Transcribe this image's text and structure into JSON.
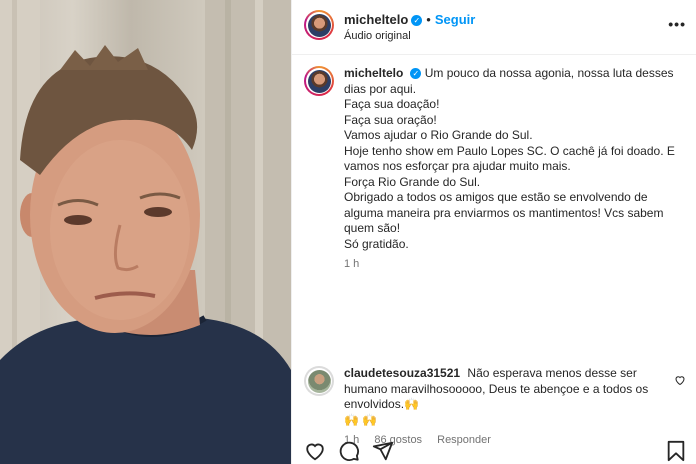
{
  "post": {
    "username": "micheltelo",
    "follow_label": "Seguir",
    "audio_label": "Áudio original",
    "more_label": "•••"
  },
  "caption": {
    "username": "micheltelo",
    "lines": [
      "Um pouco da nossa agonia, nossa luta desses dias por aqui.",
      "Faça sua doação!",
      "Faça sua oração!",
      "Vamos ajudar o Rio Grande do Sul.",
      "Hoje tenho show em Paulo Lopes SC. O cachê já foi doado. E vamos nos esforçar pra ajudar muito mais.",
      "Força Rio Grande do Sul.",
      "Obrigado a todos os amigos que estão se envolvendo de alguma maneira pra enviarmos os mantimentos! Vcs sabem quem são!",
      "Só gratidão."
    ],
    "time": "1 h"
  },
  "comment": {
    "username": "claudetesouza31521",
    "text": "Não esperava menos desse ser humano maravilhosooooo, Deus te abençoe e a todos os envolvidos.🙌",
    "emoji_line": "🙌 🙌",
    "time": "1 h",
    "likes": "86 gostos",
    "reply_label": "Responder"
  },
  "icons": {
    "like": "heart-icon",
    "comment": "comment-icon",
    "share": "share-icon",
    "save": "bookmark-icon",
    "verified": "verified-badge-icon",
    "comment_like": "small-heart-icon"
  },
  "colors": {
    "link_blue": "#0095f6",
    "verified_blue": "#0095f6",
    "muted_text": "#737373"
  }
}
